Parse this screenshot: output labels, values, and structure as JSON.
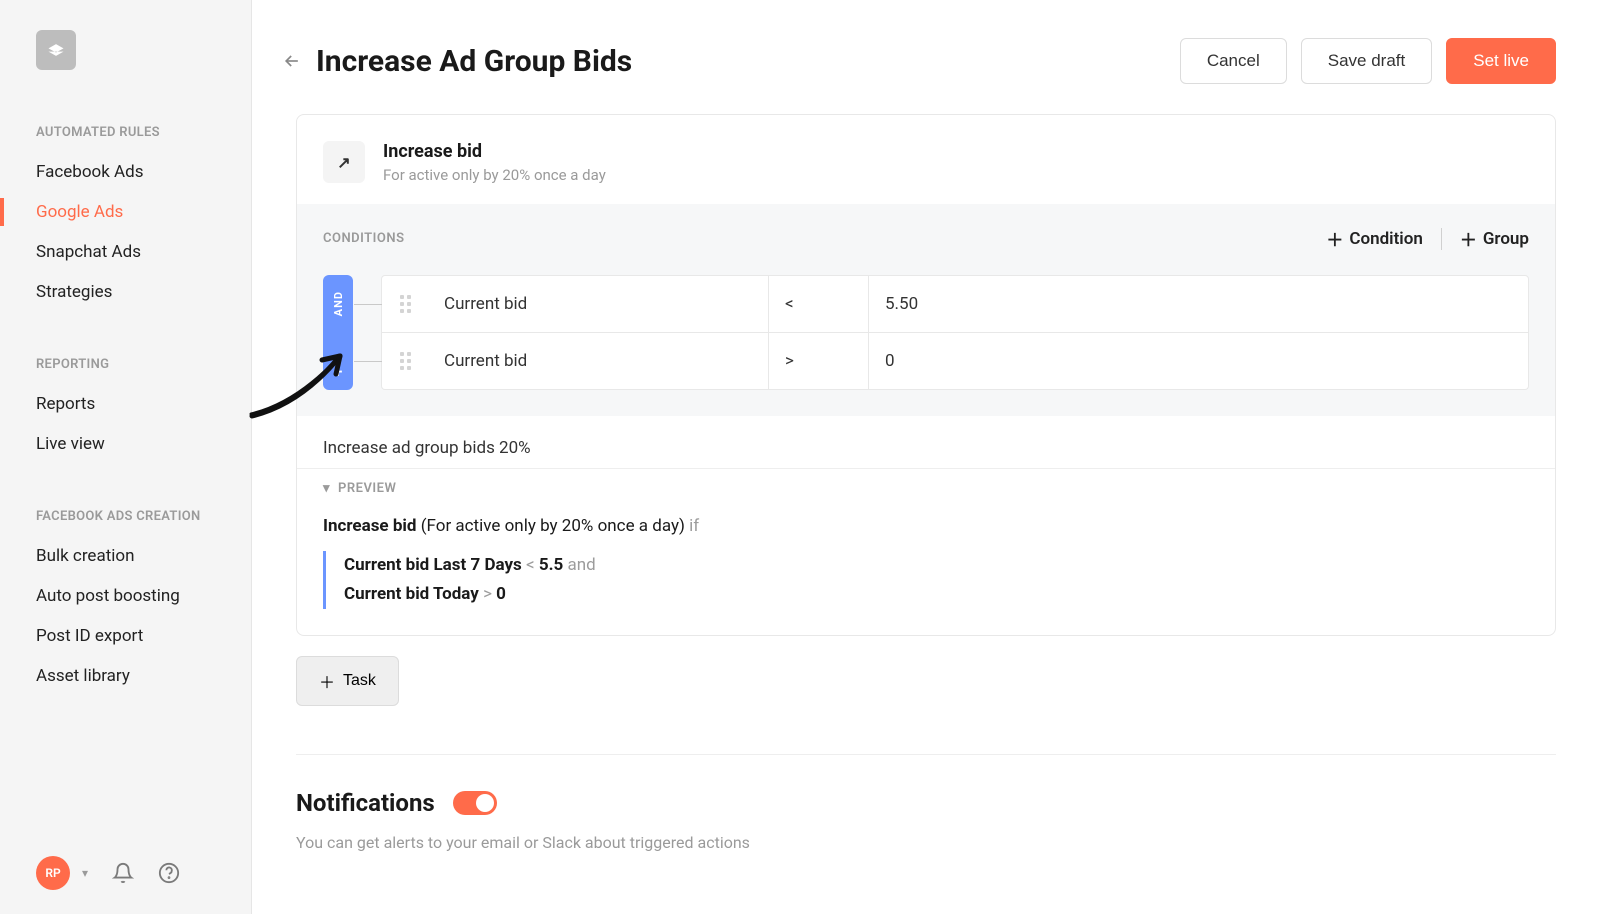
{
  "sidebar": {
    "sections": [
      {
        "title": "AUTOMATED RULES",
        "items": [
          "Facebook Ads",
          "Google Ads",
          "Snapchat Ads",
          "Strategies"
        ],
        "activeIndex": 1
      },
      {
        "title": "REPORTING",
        "items": [
          "Reports",
          "Live view"
        ]
      },
      {
        "title": "FACEBOOK ADS CREATION",
        "items": [
          "Bulk creation",
          "Auto post boosting",
          "Post ID export",
          "Asset library"
        ]
      }
    ],
    "avatar": "RP"
  },
  "header": {
    "title": "Increase Ad Group Bids",
    "cancel": "Cancel",
    "save_draft": "Save draft",
    "set_live": "Set live"
  },
  "action": {
    "icon_glyph": "↗",
    "title": "Increase bid",
    "subtitle": "For active only by 20% once a day"
  },
  "conditions": {
    "label": "CONDITIONS",
    "add_condition": "Condition",
    "add_group": "Group",
    "operator": "AND",
    "rows": [
      {
        "field": "Current bid",
        "op": "<",
        "value": "5.50"
      },
      {
        "field": "Current bid",
        "op": ">",
        "value": "0"
      }
    ]
  },
  "summary": "Increase ad group bids 20%",
  "preview": {
    "label": "PREVIEW",
    "action_name": "Increase bid",
    "action_detail": " (For active only by 20% once a day) ",
    "if_word": "if",
    "lines": [
      {
        "field": "Current bid Last 7 Days",
        "op": "<",
        "value": "5.5",
        "tail": "and"
      },
      {
        "field": "Current bid Today",
        "op": ">",
        "value": "0",
        "tail": ""
      }
    ]
  },
  "task_label": "Task",
  "notifications": {
    "title": "Notifications",
    "subtitle": "You can get alerts to your email or Slack about triggered actions",
    "enabled": true
  }
}
